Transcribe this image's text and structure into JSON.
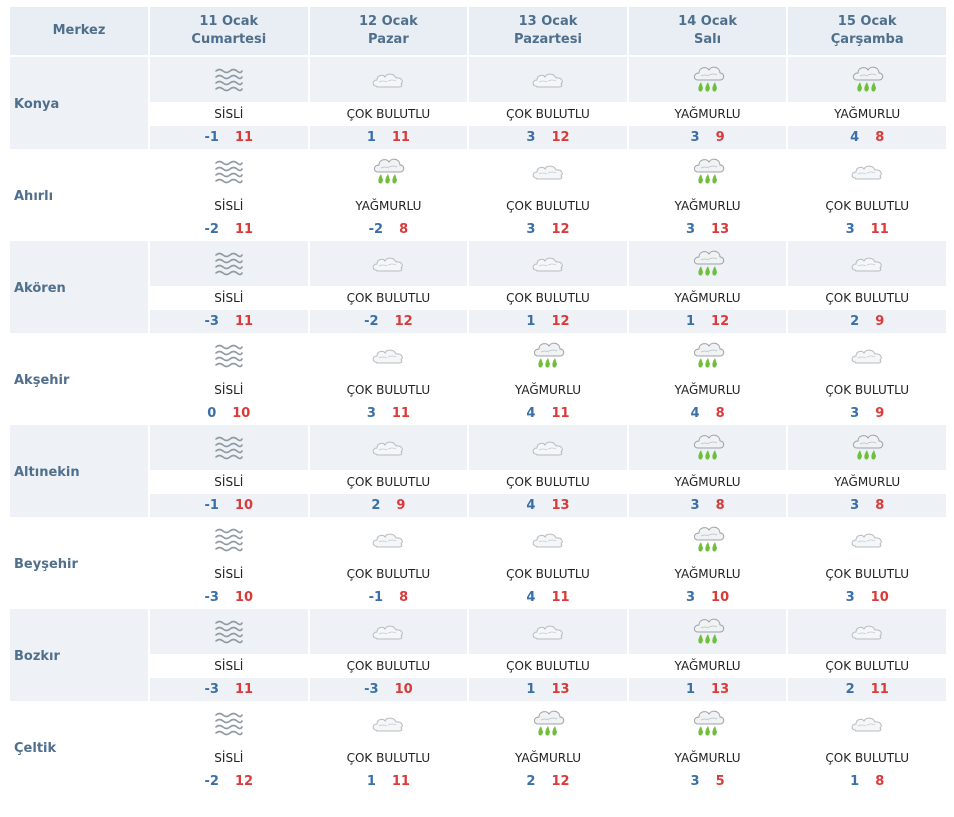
{
  "header": {
    "first_col": "Merkez",
    "days": [
      {
        "date": "11 Ocak",
        "weekday": "Cumartesi"
      },
      {
        "date": "12 Ocak",
        "weekday": "Pazar"
      },
      {
        "date": "13 Ocak",
        "weekday": "Pazartesi"
      },
      {
        "date": "14 Ocak",
        "weekday": "Salı"
      },
      {
        "date": "15 Ocak",
        "weekday": "Çarşamba"
      }
    ]
  },
  "icons": {
    "SİSLİ": "fog-icon",
    "ÇOK BULUTLU": "cloud-icon",
    "YAĞMURLU": "rain-icon"
  },
  "colors": {
    "header_bg": "#e8eef3",
    "row_alt_bg": "#eef2f6",
    "text_blue": "#4f6f8c",
    "min_temp": "#3a6fa8",
    "max_temp": "#d93a3a"
  },
  "cities": [
    {
      "name": "Konya",
      "days": [
        {
          "cond": "SİSLİ",
          "min": "-1",
          "max": "11"
        },
        {
          "cond": "ÇOK BULUTLU",
          "min": "1",
          "max": "11"
        },
        {
          "cond": "ÇOK BULUTLU",
          "min": "3",
          "max": "12"
        },
        {
          "cond": "YAĞMURLU",
          "min": "3",
          "max": "9"
        },
        {
          "cond": "YAĞMURLU",
          "min": "4",
          "max": "8"
        }
      ]
    },
    {
      "name": "Ahırlı",
      "days": [
        {
          "cond": "SİSLİ",
          "min": "-2",
          "max": "11"
        },
        {
          "cond": "YAĞMURLU",
          "min": "-2",
          "max": "8"
        },
        {
          "cond": "ÇOK BULUTLU",
          "min": "3",
          "max": "12"
        },
        {
          "cond": "YAĞMURLU",
          "min": "3",
          "max": "13"
        },
        {
          "cond": "ÇOK BULUTLU",
          "min": "3",
          "max": "11"
        }
      ]
    },
    {
      "name": "Akören",
      "days": [
        {
          "cond": "SİSLİ",
          "min": "-3",
          "max": "11"
        },
        {
          "cond": "ÇOK BULUTLU",
          "min": "-2",
          "max": "12"
        },
        {
          "cond": "ÇOK BULUTLU",
          "min": "1",
          "max": "12"
        },
        {
          "cond": "YAĞMURLU",
          "min": "1",
          "max": "12"
        },
        {
          "cond": "ÇOK BULUTLU",
          "min": "2",
          "max": "9"
        }
      ]
    },
    {
      "name": "Akşehir",
      "days": [
        {
          "cond": "SİSLİ",
          "min": "0",
          "max": "10"
        },
        {
          "cond": "ÇOK BULUTLU",
          "min": "3",
          "max": "11"
        },
        {
          "cond": "YAĞMURLU",
          "min": "4",
          "max": "11"
        },
        {
          "cond": "YAĞMURLU",
          "min": "4",
          "max": "8"
        },
        {
          "cond": "ÇOK BULUTLU",
          "min": "3",
          "max": "9"
        }
      ]
    },
    {
      "name": "Altınekin",
      "days": [
        {
          "cond": "SİSLİ",
          "min": "-1",
          "max": "10"
        },
        {
          "cond": "ÇOK BULUTLU",
          "min": "2",
          "max": "9"
        },
        {
          "cond": "ÇOK BULUTLU",
          "min": "4",
          "max": "13"
        },
        {
          "cond": "YAĞMURLU",
          "min": "3",
          "max": "8"
        },
        {
          "cond": "YAĞMURLU",
          "min": "3",
          "max": "8"
        }
      ]
    },
    {
      "name": "Beyşehir",
      "days": [
        {
          "cond": "SİSLİ",
          "min": "-3",
          "max": "10"
        },
        {
          "cond": "ÇOK BULUTLU",
          "min": "-1",
          "max": "8"
        },
        {
          "cond": "ÇOK BULUTLU",
          "min": "4",
          "max": "11"
        },
        {
          "cond": "YAĞMURLU",
          "min": "3",
          "max": "10"
        },
        {
          "cond": "ÇOK BULUTLU",
          "min": "3",
          "max": "10"
        }
      ]
    },
    {
      "name": "Bozkır",
      "days": [
        {
          "cond": "SİSLİ",
          "min": "-3",
          "max": "11"
        },
        {
          "cond": "ÇOK BULUTLU",
          "min": "-3",
          "max": "10"
        },
        {
          "cond": "ÇOK BULUTLU",
          "min": "1",
          "max": "13"
        },
        {
          "cond": "YAĞMURLU",
          "min": "1",
          "max": "13"
        },
        {
          "cond": "ÇOK BULUTLU",
          "min": "2",
          "max": "11"
        }
      ]
    },
    {
      "name": "Çeltik",
      "days": [
        {
          "cond": "SİSLİ",
          "min": "-2",
          "max": "12"
        },
        {
          "cond": "ÇOK BULUTLU",
          "min": "1",
          "max": "11"
        },
        {
          "cond": "YAĞMURLU",
          "min": "2",
          "max": "12"
        },
        {
          "cond": "YAĞMURLU",
          "min": "3",
          "max": "5"
        },
        {
          "cond": "ÇOK BULUTLU",
          "min": "1",
          "max": "8"
        }
      ]
    }
  ]
}
